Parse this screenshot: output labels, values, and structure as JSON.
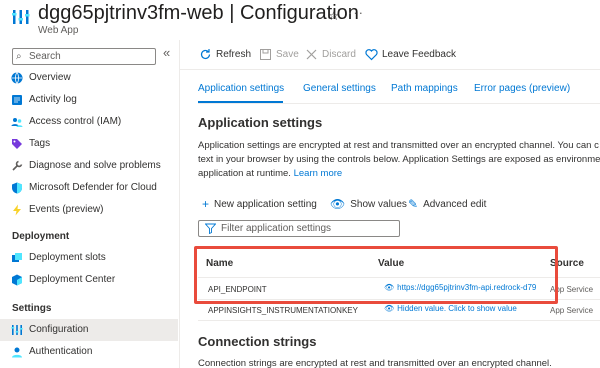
{
  "header": {
    "title": "dgg65pjtrinv3fm-web | Configuration",
    "subtitle": "Web App",
    "more": "···"
  },
  "sidebar": {
    "search_placeholder": "Search",
    "collapse": "«",
    "items_top": [
      {
        "label": "Overview",
        "icon": "globe-icon"
      },
      {
        "label": "Activity log",
        "icon": "activity-log-icon"
      },
      {
        "label": "Access control (IAM)",
        "icon": "people-icon"
      },
      {
        "label": "Tags",
        "icon": "tag-icon"
      },
      {
        "label": "Diagnose and solve problems",
        "icon": "wrench-icon"
      },
      {
        "label": "Microsoft Defender for Cloud",
        "icon": "shield-icon"
      },
      {
        "label": "Events (preview)",
        "icon": "lightning-icon"
      }
    ],
    "section_deployment": "Deployment",
    "items_deployment": [
      {
        "label": "Deployment slots",
        "icon": "slots-icon"
      },
      {
        "label": "Deployment Center",
        "icon": "cube-icon"
      }
    ],
    "section_settings": "Settings",
    "items_settings": [
      {
        "label": "Configuration",
        "icon": "configuration-icon",
        "active": true
      },
      {
        "label": "Authentication",
        "icon": "user-icon"
      }
    ]
  },
  "toolbar": {
    "refresh": "Refresh",
    "save": "Save",
    "discard": "Discard",
    "feedback": "Leave Feedback"
  },
  "tabs": [
    {
      "label": "Application settings",
      "active": true
    },
    {
      "label": "General settings"
    },
    {
      "label": "Path mappings"
    },
    {
      "label": "Error pages (preview)"
    }
  ],
  "main": {
    "section_title": "Application settings",
    "desc_line1": "Application settings are encrypted at rest and transmitted over an encrypted channel. You can c",
    "desc_line2": "text in your browser by using the controls below. Application Settings are exposed as environme",
    "desc_line3": "application at runtime. ",
    "learn_more": "Learn more",
    "new_setting": "New application setting",
    "show_values": "Show values",
    "advanced_edit": "Advanced edit",
    "filter_placeholder": "Filter application settings"
  },
  "table": {
    "columns": [
      "Name",
      "Value",
      "Source"
    ],
    "rows": [
      {
        "name": "API_ENDPOINT",
        "value": "https://dgg65pjtrinv3fm-api.redrock-d79",
        "source": "App Service"
      },
      {
        "name": "APPINSIGHTS_INSTRUMENTATIONKEY",
        "value": "Hidden value. Click to show value",
        "source": "App Service"
      }
    ]
  },
  "connection": {
    "title": "Connection strings",
    "desc": "Connection strings are encrypted at rest and transmitted over an encrypted channel."
  },
  "colors": {
    "accent": "#0078d4",
    "highlight": "#e94b3c",
    "active_nav": "#edebe9"
  }
}
